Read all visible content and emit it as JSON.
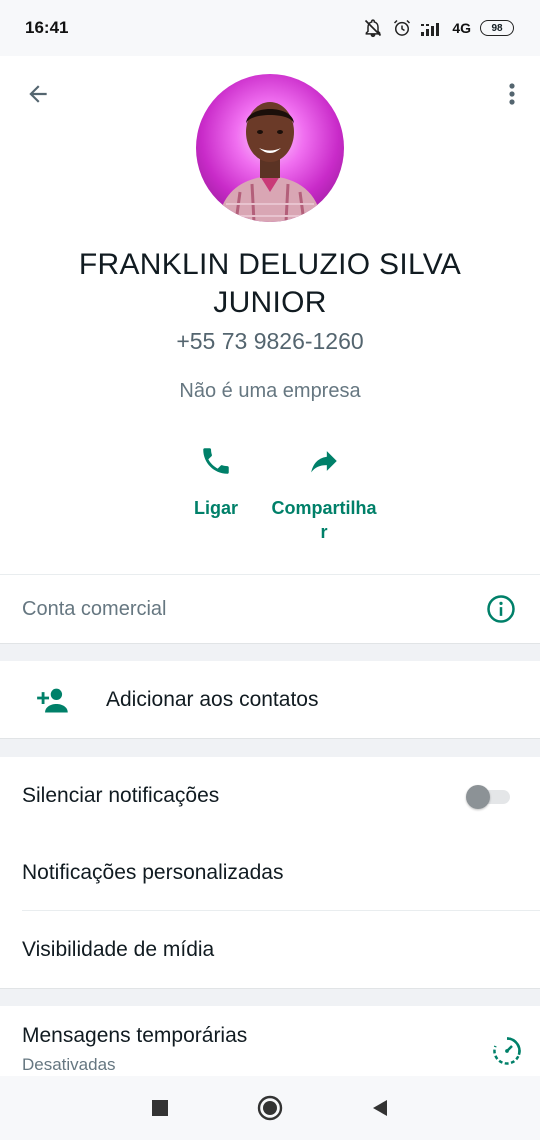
{
  "status_bar": {
    "time": "16:41",
    "network": "4G",
    "battery": "98",
    "icons": [
      "mute-icon",
      "alarm-icon",
      "signal-icon",
      "battery-icon"
    ]
  },
  "contact": {
    "name": "FRANKLIN DELUZIO SILVA JUNIOR",
    "phone": "+55 73 9826-1260",
    "business_note": "Não é uma empresa"
  },
  "actions": [
    {
      "label": "Ligar",
      "icon": "phone-icon"
    },
    {
      "label": "Compartilhar",
      "icon": "share-icon"
    }
  ],
  "business_account": {
    "label": "Conta comercial",
    "icon": "info-icon"
  },
  "add_contact": {
    "label": "Adicionar aos contatos",
    "icon": "add-person-icon"
  },
  "settings": {
    "mute_label": "Silenciar notificações",
    "mute_enabled": false,
    "custom_notifications_label": "Notificações personalizadas",
    "media_visibility_label": "Visibilidade de mídia"
  },
  "temporary_messages": {
    "label": "Mensagens temporárias",
    "status": "Desativadas",
    "icon": "timer-icon"
  },
  "colors": {
    "accent": "#008069",
    "text_primary": "#111b21",
    "text_secondary": "#667781",
    "background": "#f0f2f5"
  }
}
